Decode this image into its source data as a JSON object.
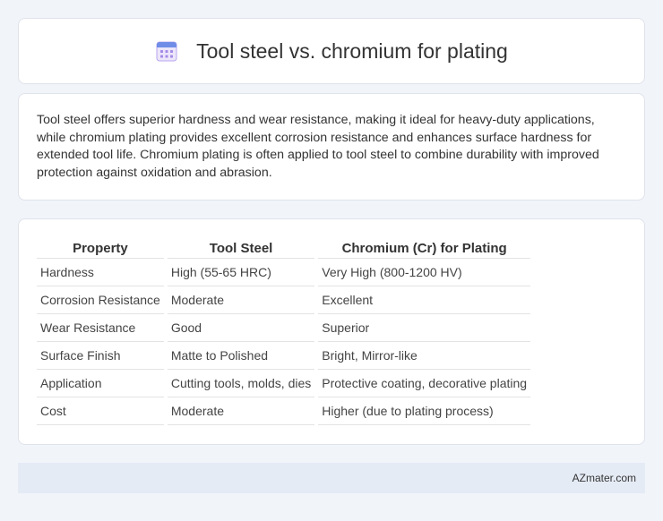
{
  "header": {
    "title": "Tool steel vs. chromium for plating",
    "icon": "calendar-icon"
  },
  "description": "Tool steel offers superior hardness and wear resistance, making it ideal for heavy-duty applications, while chromium plating provides excellent corrosion resistance and enhances surface hardness for extended tool life. Chromium plating is often applied to tool steel to combine durability with improved protection against oxidation and abrasion.",
  "table": {
    "headers": [
      "Property",
      "Tool Steel",
      "Chromium (Cr) for Plating"
    ],
    "rows": [
      [
        "Hardness",
        "High (55-65 HRC)",
        "Very High (800-1200 HV)"
      ],
      [
        "Corrosion Resistance",
        "Moderate",
        "Excellent"
      ],
      [
        "Wear Resistance",
        "Good",
        "Superior"
      ],
      [
        "Surface Finish",
        "Matte to Polished",
        "Bright, Mirror-like"
      ],
      [
        "Application",
        "Cutting tools, molds, dies",
        "Protective coating, decorative plating"
      ],
      [
        "Cost",
        "Moderate",
        "Higher (due to plating process)"
      ]
    ]
  },
  "footer": {
    "text": "AZmater.com"
  }
}
